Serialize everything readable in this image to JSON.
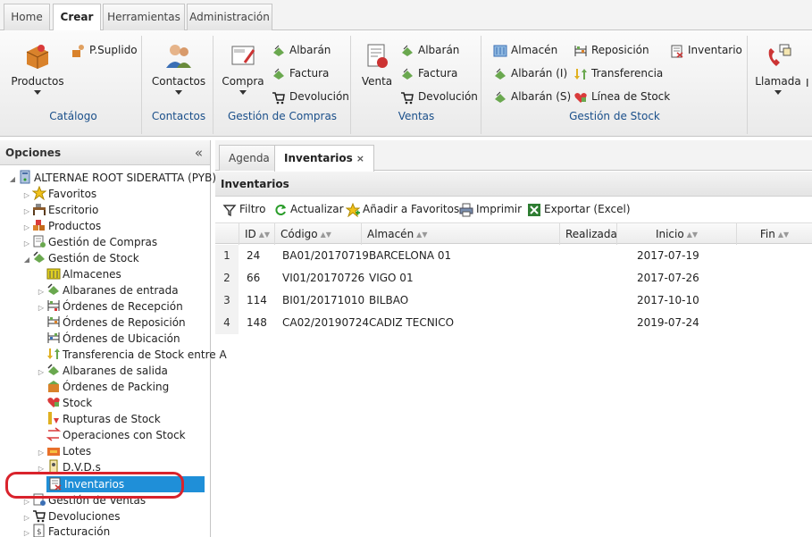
{
  "top_tabs": [
    "Home",
    "Crear",
    "Herramientas",
    "Administración"
  ],
  "active_top_tab": "Crear",
  "ribbon": {
    "catalogo": {
      "productos": "Productos",
      "psuplido": "P.Suplido",
      "group": "Catálogo"
    },
    "contactos": {
      "contactos": "Contactos",
      "group": "Contactos"
    },
    "compras": {
      "compra": "Compra",
      "albaran": "Albarán",
      "factura": "Factura",
      "devolucion": "Devolución",
      "group": "Gestión de Compras"
    },
    "ventas": {
      "venta": "Venta",
      "albaran": "Albarán",
      "factura": "Factura",
      "devolucion": "Devolución",
      "group": "Ventas"
    },
    "stock": {
      "almacen": "Almacén",
      "albaran_i": "Albarán (I)",
      "albaran_s": "Albarán (S)",
      "reposicion": "Reposición",
      "transferencia": "Transferencia",
      "linea_stock": "Línea de Stock",
      "inventario": "Inventario",
      "group": "Gestión de Stock"
    },
    "llamada": {
      "llamada": "Llamada",
      "cut": "I"
    }
  },
  "left_panel": {
    "title": "Opciones",
    "collapse": "«",
    "root": "ALTERNAE ROOT SIDERATTA (PYB)",
    "items": [
      "Favoritos",
      "Escritorio",
      "Productos",
      "Gestión de Compras",
      "Gestión de Stock"
    ],
    "stock_children": [
      "Almacenes",
      "Albaranes de entrada",
      "Órdenes de Recepción",
      "Órdenes de Reposición",
      "Órdenes de Ubicación",
      "Transferencia de Stock entre A",
      "Albaranes de salida",
      "Órdenes de Packing",
      "Stock",
      "Rupturas de Stock",
      "Operaciones con Stock",
      "Lotes",
      "D.V.D.s",
      "Inventarios"
    ],
    "after_items": [
      "Gestión de Ventas",
      "Devoluciones",
      "Facturación"
    ],
    "selected": "Inventarios"
  },
  "content": {
    "tabs": [
      "Agenda",
      "Inventarios"
    ],
    "tab_close": "×",
    "panel_title": "Inventarios",
    "toolbar": {
      "filtro": "Filtro",
      "actualizar": "Actualizar",
      "favoritos": "Añadir a Favoritos",
      "imprimir": "Imprimir",
      "exportar": "Exportar (Excel)"
    },
    "columns": [
      "ID",
      "Código",
      "Almacén",
      "Realizada",
      "Inicio",
      "Fin"
    ],
    "rows": [
      {
        "n": "1",
        "id": "24",
        "codigo": "BA01/20170719",
        "almacen": "BARCELONA 01",
        "realizada": "",
        "inicio": "2017-07-19",
        "fin": ""
      },
      {
        "n": "2",
        "id": "66",
        "codigo": "VI01/20170726",
        "almacen": "VIGO 01",
        "realizada": "",
        "inicio": "2017-07-26",
        "fin": ""
      },
      {
        "n": "3",
        "id": "114",
        "codigo": "BI01/20171010",
        "almacen": "BILBAO",
        "realizada": "",
        "inicio": "2017-10-10",
        "fin": ""
      },
      {
        "n": "4",
        "id": "148",
        "codigo": "CA02/20190724",
        "almacen": "CADIZ TECNICO",
        "realizada": "",
        "inicio": "2019-07-24",
        "fin": ""
      }
    ]
  }
}
